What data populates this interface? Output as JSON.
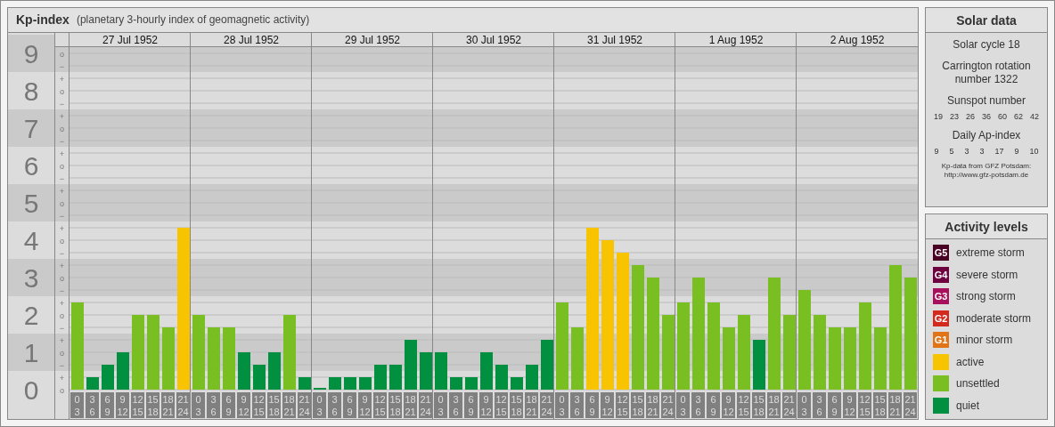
{
  "header": {
    "title": "Kp-index",
    "subtitle": "(planetary 3-hourly index of geomagnetic activity)"
  },
  "axis_levels": [
    {
      "marks": [
        "o",
        "−"
      ]
    },
    {
      "marks": [
        "+",
        "o",
        "−"
      ]
    },
    {
      "marks": [
        "+",
        "o",
        "−"
      ]
    },
    {
      "marks": [
        "+",
        "o",
        "−"
      ]
    },
    {
      "marks": [
        "+",
        "o",
        "−"
      ]
    },
    {
      "marks": [
        "+",
        "o",
        "−"
      ]
    },
    {
      "marks": [
        "+",
        "o",
        "−"
      ]
    },
    {
      "marks": [
        "+",
        "o",
        "−"
      ]
    },
    {
      "marks": [
        "+",
        "o",
        "−"
      ]
    },
    {
      "marks": [
        "+",
        "o"
      ]
    }
  ],
  "days": [
    {
      "date": "27 Jul 1952",
      "slots": [
        {
          "start": "0",
          "end": "3"
        },
        {
          "start": "3",
          "end": "6"
        },
        {
          "start": "6",
          "end": "9"
        },
        {
          "start": "9",
          "end": "12"
        },
        {
          "start": "12",
          "end": "15"
        },
        {
          "start": "15",
          "end": "18"
        },
        {
          "start": "18",
          "end": "21"
        },
        {
          "start": "21",
          "end": "24"
        }
      ]
    },
    {
      "date": "28 Jul 1952",
      "slots": [
        {
          "start": "0",
          "end": "3"
        },
        {
          "start": "3",
          "end": "6"
        },
        {
          "start": "6",
          "end": "9"
        },
        {
          "start": "9",
          "end": "12"
        },
        {
          "start": "12",
          "end": "15"
        },
        {
          "start": "15",
          "end": "18"
        },
        {
          "start": "18",
          "end": "21"
        },
        {
          "start": "21",
          "end": "24"
        }
      ]
    },
    {
      "date": "29 Jul 1952",
      "slots": [
        {
          "start": "0",
          "end": "3"
        },
        {
          "start": "3",
          "end": "6"
        },
        {
          "start": "6",
          "end": "9"
        },
        {
          "start": "9",
          "end": "12"
        },
        {
          "start": "12",
          "end": "15"
        },
        {
          "start": "15",
          "end": "18"
        },
        {
          "start": "18",
          "end": "21"
        },
        {
          "start": "21",
          "end": "24"
        }
      ]
    },
    {
      "date": "30 Jul 1952",
      "slots": [
        {
          "start": "0",
          "end": "3"
        },
        {
          "start": "3",
          "end": "6"
        },
        {
          "start": "6",
          "end": "9"
        },
        {
          "start": "9",
          "end": "12"
        },
        {
          "start": "12",
          "end": "15"
        },
        {
          "start": "15",
          "end": "18"
        },
        {
          "start": "18",
          "end": "21"
        },
        {
          "start": "21",
          "end": "24"
        }
      ]
    },
    {
      "date": "31 Jul 1952",
      "slots": [
        {
          "start": "0",
          "end": "3"
        },
        {
          "start": "3",
          "end": "6"
        },
        {
          "start": "6",
          "end": "9"
        },
        {
          "start": "9",
          "end": "12"
        },
        {
          "start": "12",
          "end": "15"
        },
        {
          "start": "15",
          "end": "18"
        },
        {
          "start": "18",
          "end": "21"
        },
        {
          "start": "21",
          "end": "24"
        }
      ]
    },
    {
      "date": "1 Aug 1952",
      "slots": [
        {
          "start": "0",
          "end": "3"
        },
        {
          "start": "3",
          "end": "6"
        },
        {
          "start": "6",
          "end": "9"
        },
        {
          "start": "9",
          "end": "12"
        },
        {
          "start": "12",
          "end": "15"
        },
        {
          "start": "15",
          "end": "18"
        },
        {
          "start": "18",
          "end": "21"
        },
        {
          "start": "21",
          "end": "24"
        }
      ]
    },
    {
      "date": "2 Aug 1952",
      "slots": [
        {
          "start": "0",
          "end": "3"
        },
        {
          "start": "3",
          "end": "6"
        },
        {
          "start": "6",
          "end": "9"
        },
        {
          "start": "9",
          "end": "12"
        },
        {
          "start": "12",
          "end": "15"
        },
        {
          "start": "15",
          "end": "18"
        },
        {
          "start": "18",
          "end": "21"
        },
        {
          "start": "21",
          "end": "24"
        }
      ]
    }
  ],
  "chart_data": {
    "type": "bar",
    "stacked": true,
    "grid": true,
    "ylim": [
      0,
      9
    ],
    "yticks": [
      0,
      1,
      2,
      3,
      4,
      5,
      6,
      7,
      8,
      9
    ],
    "series": [
      {
        "name": "active",
        "color": "#f8c400",
        "values": [
          null,
          null,
          null,
          null,
          null,
          null,
          null,
          4.33,
          null,
          null,
          null,
          null,
          null,
          null,
          null,
          null,
          null,
          null,
          null,
          null,
          null,
          null,
          null,
          null,
          null,
          null,
          null,
          null,
          null,
          null,
          null,
          null,
          null,
          null,
          4.33,
          4,
          3.67,
          null,
          null,
          null,
          null,
          null,
          null,
          null,
          null,
          null,
          null,
          null,
          null,
          null,
          null,
          null,
          null,
          null,
          null,
          null
        ]
      },
      {
        "name": "unsettled",
        "color": "#7abf22",
        "values": [
          2.33,
          null,
          null,
          null,
          2,
          2,
          1.67,
          null,
          2,
          1.67,
          1.67,
          null,
          null,
          null,
          2,
          null,
          null,
          null,
          null,
          null,
          null,
          null,
          null,
          null,
          null,
          null,
          null,
          null,
          null,
          null,
          null,
          null,
          2.33,
          1.67,
          null,
          null,
          null,
          3.33,
          3,
          2,
          2.33,
          3,
          2.33,
          1.67,
          2,
          null,
          3,
          2,
          2.67,
          2,
          1.67,
          1.67,
          2.33,
          1.67,
          3.33,
          3
        ]
      },
      {
        "name": "quiet",
        "color": "#009040",
        "values": [
          null,
          0.33,
          0.67,
          1,
          null,
          null,
          null,
          null,
          null,
          null,
          null,
          1,
          0.67,
          1,
          null,
          0.33,
          0,
          0.33,
          0.33,
          0.33,
          0.67,
          0.67,
          1.33,
          1,
          1,
          0.33,
          0.33,
          1,
          0.67,
          0.33,
          0.67,
          1.33,
          null,
          null,
          null,
          null,
          null,
          null,
          null,
          null,
          null,
          null,
          null,
          null,
          null,
          1.33,
          null,
          null,
          null,
          null,
          null,
          null,
          null,
          null,
          null,
          null
        ]
      }
    ]
  },
  "solar_data": {
    "title": "Solar data",
    "cycle": "Solar cycle 18",
    "rotation": "Carrington rotation number 1322",
    "sunspot_label": "Sunspot number",
    "sunspots": [
      "19",
      "23",
      "26",
      "36",
      "60",
      "62",
      "42"
    ],
    "ap_label": "Daily Ap-index",
    "ap_values": [
      "9",
      "5",
      "3",
      "3",
      "17",
      "9",
      "10"
    ],
    "source_lines": [
      "Kp-data from GFZ Potsdam:",
      "http://www.gfz-potsdam.de"
    ]
  },
  "activity_levels": {
    "title": "Activity levels",
    "items": [
      {
        "code": "G5",
        "label": "extreme storm",
        "color": "#4a0022"
      },
      {
        "code": "G4",
        "label": "severe storm",
        "color": "#6e0040"
      },
      {
        "code": "G3",
        "label": "strong storm",
        "color": "#a8105e"
      },
      {
        "code": "G2",
        "label": "moderate storm",
        "color": "#d42a1e"
      },
      {
        "code": "G1",
        "label": "minor storm",
        "color": "#e07416"
      }
    ]
  }
}
